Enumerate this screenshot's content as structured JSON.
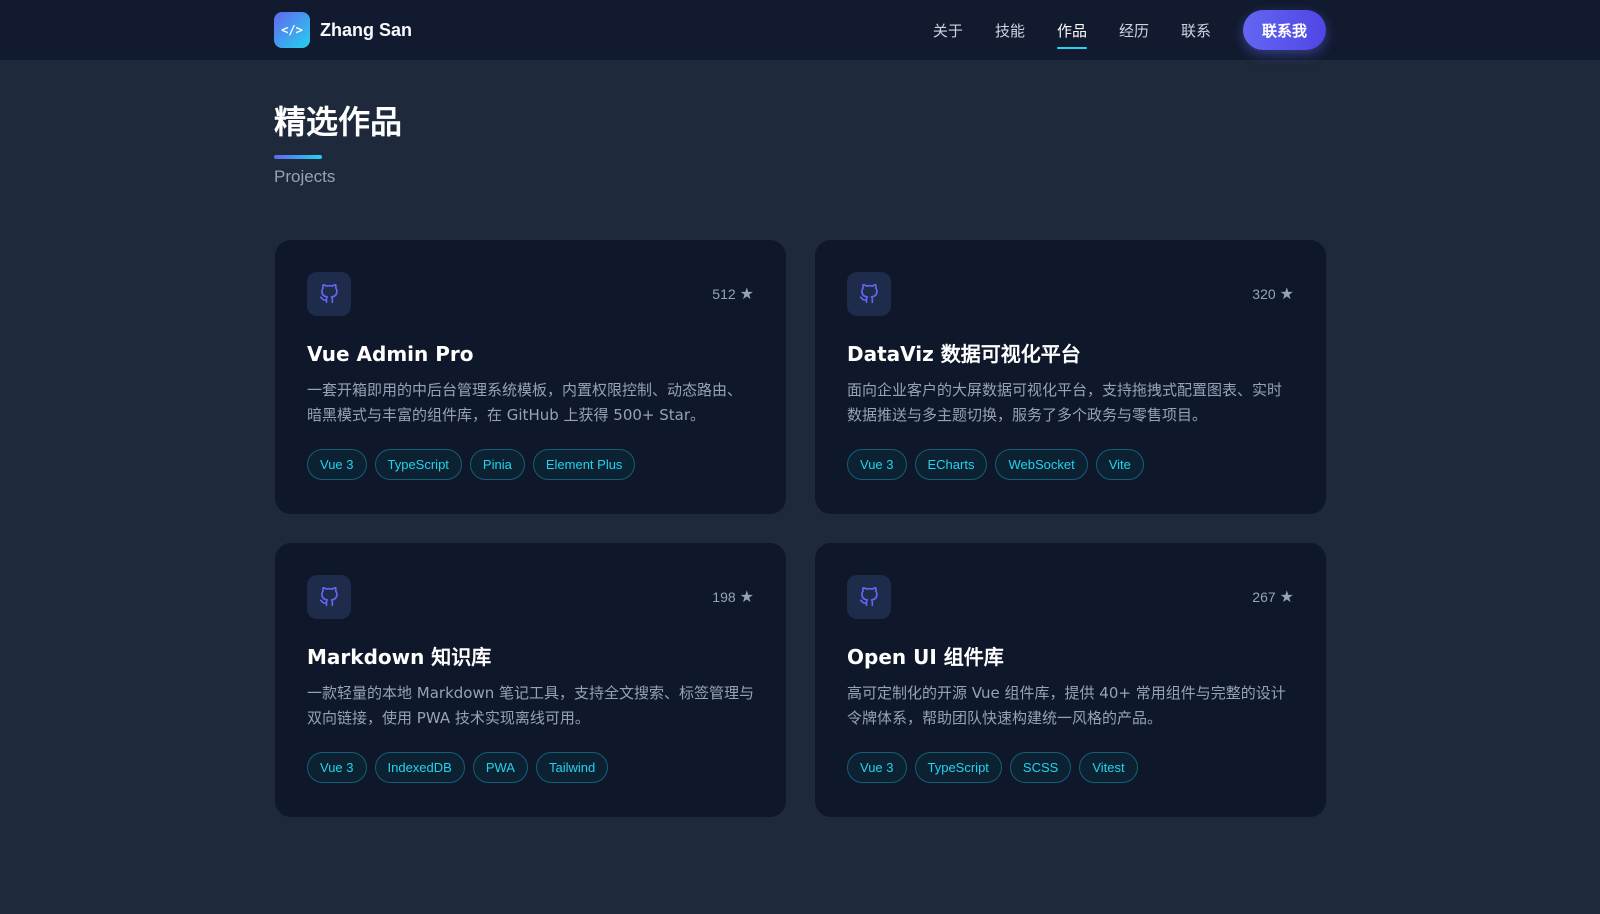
{
  "nav": {
    "logo_text": "</>",
    "brand": "Zhang San",
    "links": [
      {
        "label": "关于",
        "active": false
      },
      {
        "label": "技能",
        "active": false
      },
      {
        "label": "作品",
        "active": true
      },
      {
        "label": "经历",
        "active": false
      },
      {
        "label": "联系",
        "active": false
      }
    ],
    "cta_label": "联系我"
  },
  "section": {
    "title": "精选作品",
    "subtitle": "Projects"
  },
  "colors": {
    "accent": "#6366f1",
    "accent_secondary": "#22d3ee",
    "card_bg": "#0f172a",
    "page_bg": "#1e293b"
  },
  "projects": [
    {
      "icon": "github-icon",
      "stars": "512",
      "title": "Vue Admin Pro",
      "description": "一套开箱即用的中后台管理系统模板，内置权限控制、动态路由、暗黑模式与丰富的组件库，在 GitHub 上获得 500+ Star。",
      "tags": [
        "Vue 3",
        "TypeScript",
        "Pinia",
        "Element Plus"
      ]
    },
    {
      "icon": "github-icon",
      "stars": "320",
      "title": "DataViz 数据可视化平台",
      "description": "面向企业客户的大屏数据可视化平台，支持拖拽式配置图表、实时数据推送与多主题切换，服务了多个政务与零售项目。",
      "tags": [
        "Vue 3",
        "ECharts",
        "WebSocket",
        "Vite"
      ]
    },
    {
      "icon": "github-icon",
      "stars": "198",
      "title": "Markdown 知识库",
      "description": "一款轻量的本地 Markdown 笔记工具，支持全文搜索、标签管理与双向链接，使用 PWA 技术实现离线可用。",
      "tags": [
        "Vue 3",
        "IndexedDB",
        "PWA",
        "Tailwind"
      ]
    },
    {
      "icon": "github-icon",
      "stars": "267",
      "title": "Open UI 组件库",
      "description": "高可定制化的开源 Vue 组件库，提供 40+ 常用组件与完整的设计令牌体系，帮助团队快速构建统一风格的产品。",
      "tags": [
        "Vue 3",
        "TypeScript",
        "SCSS",
        "Vitest"
      ]
    }
  ]
}
